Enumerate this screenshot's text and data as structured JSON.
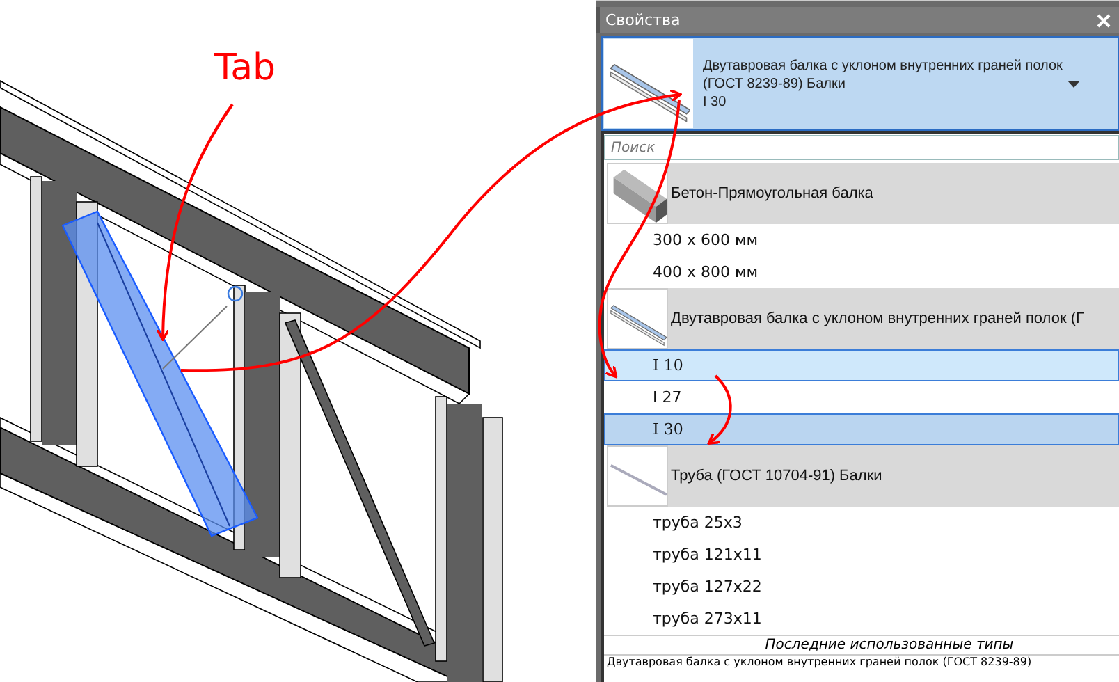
{
  "annotation": {
    "label": "Tab"
  },
  "properties_panel": {
    "title": "Свойства",
    "type_selector": {
      "kind": "ibeam",
      "name": "Двутавровая балка с уклоном внутренних граней полок (ГОСТ 8239-89) Балки",
      "type": "I 30"
    },
    "search": {
      "placeholder": "Поиск"
    },
    "families": [
      {
        "name": "Бетон-Прямоугольная балка",
        "kind": "concrete",
        "types": [
          {
            "label": "300 x 600 мм",
            "selected": false,
            "hovered": false
          },
          {
            "label": "400 x 800 мм",
            "selected": false,
            "hovered": false
          }
        ]
      },
      {
        "name": "Двутавровая балка с уклоном внутренних граней полок (Г",
        "kind": "ibeam",
        "types": [
          {
            "label": "I 10",
            "selected": false,
            "hovered": true
          },
          {
            "label": "I 27",
            "selected": false,
            "hovered": false
          },
          {
            "label": "I 30",
            "selected": true,
            "hovered": false
          }
        ]
      },
      {
        "name": "Труба (ГОСТ 10704-91) Балки",
        "kind": "pipe",
        "types": [
          {
            "label": "труба 25x3",
            "selected": false,
            "hovered": false
          },
          {
            "label": "труба 121x11",
            "selected": false,
            "hovered": false
          },
          {
            "label": "труба 127x22",
            "selected": false,
            "hovered": false
          },
          {
            "label": "труба 273x11",
            "selected": false,
            "hovered": false
          }
        ]
      }
    ],
    "recent_header": "Последние использованные типы",
    "recent": [
      {
        "label": "Двутавровая балка с уклоном внутренних граней полок (ГОСТ 8239-89)"
      }
    ]
  }
}
